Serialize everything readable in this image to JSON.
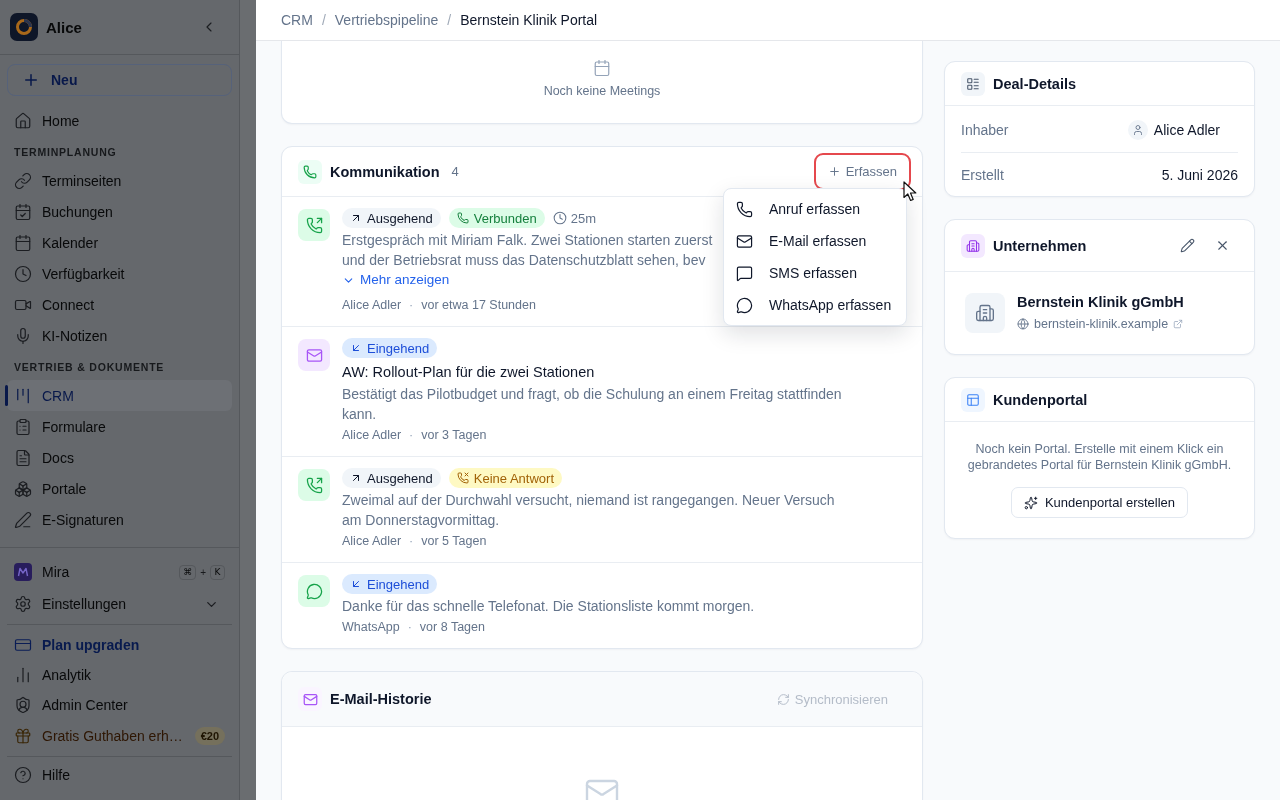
{
  "sidebar": {
    "workspace": "Alice",
    "new_button": {
      "label": "Neu"
    },
    "home": {
      "label": "Home",
      "selected": false
    },
    "sections": [
      {
        "heading": "TERMINPLANUNG",
        "items": [
          {
            "label": "Terminseiten",
            "selected": false
          },
          {
            "label": "Buchungen",
            "selected": false
          },
          {
            "label": "Kalender",
            "selected": false
          },
          {
            "label": "Verfügbarkeit",
            "selected": false
          },
          {
            "label": "Connect",
            "selected": false
          },
          {
            "label": "KI-Notizen",
            "selected": false
          }
        ]
      },
      {
        "heading": "VERTRIEB & DOKUMENTE",
        "items": [
          {
            "label": "CRM",
            "selected": true
          },
          {
            "label": "Formulare",
            "selected": false
          },
          {
            "label": "Docs",
            "selected": false
          },
          {
            "label": "Portale",
            "selected": false
          },
          {
            "label": "E-Signaturen",
            "selected": false
          }
        ]
      }
    ],
    "assistant": {
      "label": "Mira",
      "shortcut": [
        {
          "kind": "key",
          "label": "⌘"
        },
        {
          "kind": "joiner",
          "label": "+"
        },
        {
          "kind": "key",
          "label": "K"
        }
      ]
    },
    "settings": {
      "label": "Einstellungen",
      "expanded": false
    },
    "links": [
      {
        "kind": "upgrade",
        "label": "Plan upgraden"
      },
      {
        "kind": "plain",
        "label": "Analytik"
      },
      {
        "kind": "plain",
        "label": "Admin Center"
      },
      {
        "kind": "promo",
        "label": "Gratis Guthaben erh…",
        "badge": "€20"
      }
    ],
    "help": {
      "label": "Hilfe"
    }
  },
  "breadcrumb": {
    "items": [
      {
        "label": "CRM",
        "current": false
      },
      {
        "label": "Vertriebspipeline",
        "current": false
      },
      {
        "label": "Bernstein Klinik Portal",
        "current": true
      }
    ],
    "separators": [
      "/",
      "/"
    ]
  },
  "meetings": {
    "empty_text": "Noch keine Meetings"
  },
  "communication": {
    "title": "Kommunikation",
    "count": "4",
    "add_button": {
      "label": "Erfassen",
      "expanded": true,
      "highlighted": true
    },
    "menu": [
      {
        "kind": "call",
        "label": "Anruf erfassen"
      },
      {
        "kind": "email",
        "label": "E-Mail erfassen"
      },
      {
        "kind": "sms",
        "label": "SMS erfassen"
      },
      {
        "kind": "whatsapp",
        "label": "WhatsApp erfassen"
      }
    ],
    "entries": [
      {
        "kind": "call",
        "badges": [
          {
            "kind": "outgoing",
            "label": "Ausgehend"
          },
          {
            "kind": "connected",
            "label": "Verbunden"
          }
        ],
        "duration": "25m",
        "preview": "Erstgespräch mit Miriam Falk. Zwei Stationen starten zuerst und der Betriebsrat muss das Datenschutzblatt sehen, bev",
        "more_link": "Mehr anzeigen",
        "author": "Alice Adler",
        "separator": "·",
        "time": "vor etwa 17 Stunden"
      },
      {
        "kind": "email",
        "badges": [
          {
            "kind": "incoming",
            "label": "Eingehend"
          }
        ],
        "subject": "AW: Rollout-Plan für die zwei Stationen",
        "preview": "Bestätigt das Pilotbudget und fragt, ob die Schulung an einem Freitag stattfinden kann.",
        "author": "Alice Adler",
        "separator": "·",
        "time": "vor 3 Tagen"
      },
      {
        "kind": "call",
        "badges": [
          {
            "kind": "outgoing",
            "label": "Ausgehend"
          },
          {
            "kind": "no_answer",
            "label": "Keine Antwort"
          }
        ],
        "preview": "Zweimal auf der Durchwahl versucht, niemand ist rangegangen. Neuer Versuch am Donnerstagvormittag.",
        "author": "Alice Adler",
        "separator": "·",
        "time": "vor 5 Tagen"
      },
      {
        "kind": "whatsapp",
        "badges": [
          {
            "kind": "incoming",
            "label": "Eingehend"
          }
        ],
        "preview": "Danke für das schnelle Telefonat. Die Stationsliste kommt morgen.",
        "author": "WhatsApp",
        "separator": "·",
        "time": "vor 8 Tagen"
      }
    ]
  },
  "email_history": {
    "title": "E-Mail-Historie",
    "sync_button": {
      "label": "Synchronisieren",
      "disabled": true
    }
  },
  "deal_details": {
    "title": "Deal-Details",
    "fields": [
      {
        "kind": "person",
        "label": "Inhaber",
        "value": "Alice Adler"
      },
      {
        "kind": "text",
        "label": "Erstellt",
        "value": "5. Juni 2026"
      }
    ]
  },
  "company": {
    "title": "Unternehmen",
    "name": "Bernstein Klinik gGmbH",
    "website": "bernstein-klinik.example"
  },
  "customer_portal": {
    "title": "Kundenportal",
    "description": "Noch kein Portal. Erstelle mit einem Klick ein gebrandetes Portal für Bernstein Klinik gGmbH.",
    "button": "Kundenportal erstellen"
  }
}
